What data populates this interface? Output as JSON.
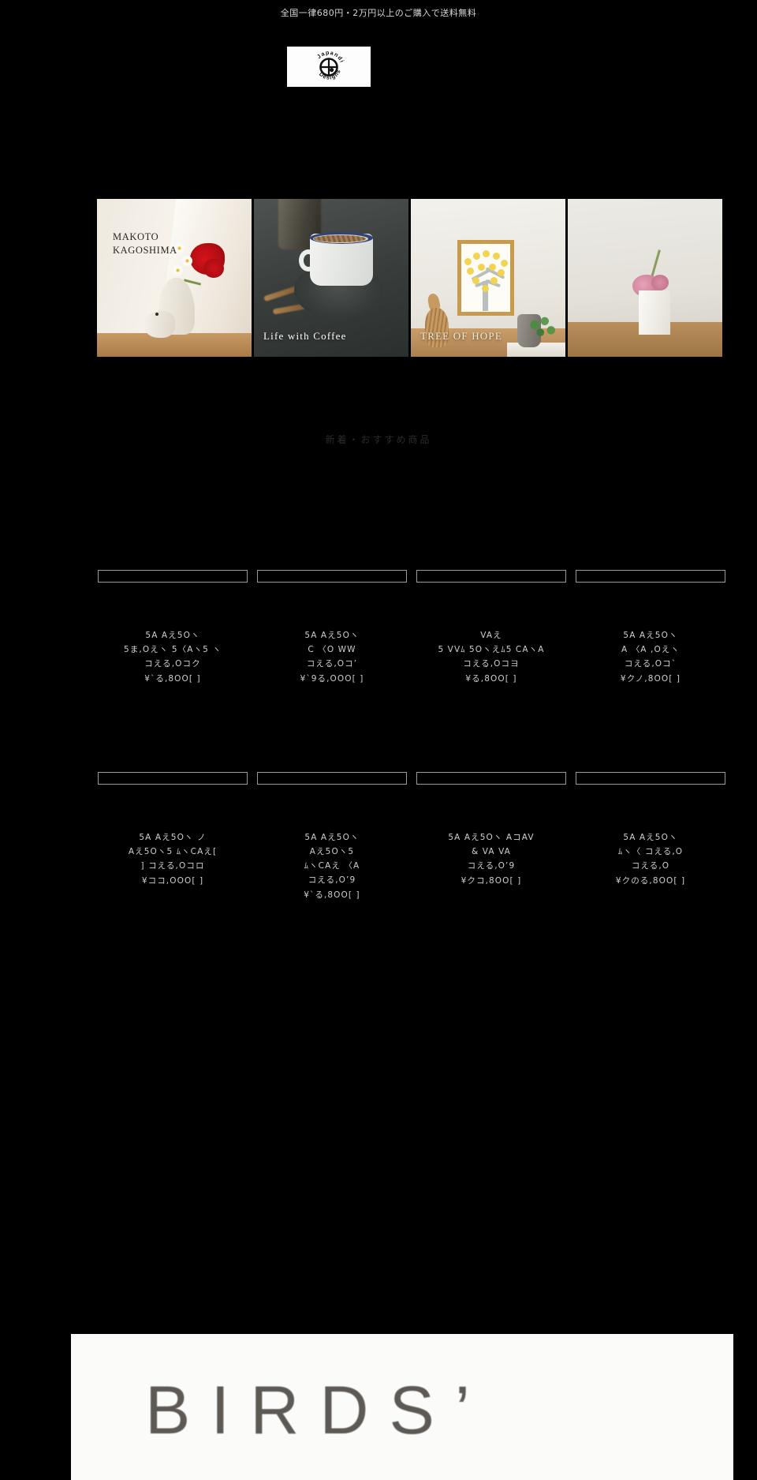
{
  "announcement": {
    "text": "全国一律680円・2万円以上のご購入で送料無料"
  },
  "logo": {
    "name": "Japandi Designs",
    "top_text": "Japandi",
    "bottom_text": "Designs",
    "background": "#fdfdfd",
    "mark_color": "#111111"
  },
  "carousel": {
    "slides": [
      {
        "caption": "MAKOTO\nKAGOSHIMA",
        "caption_line1": "MAKOTO",
        "caption_line2": "KAGOSHIMA",
        "position": "top-left",
        "style": "dark"
      },
      {
        "caption": "Life with Coffee",
        "position": "bottom-left",
        "style": "light"
      },
      {
        "caption": "TREE OF HOPE",
        "position": "bottom-left",
        "style": "cream"
      },
      {
        "caption": "",
        "position": "bottom-left",
        "style": "light"
      }
    ]
  },
  "section": {
    "heading": "新着・おすすめ商品"
  },
  "products": {
    "row1": [
      {
        "title": "5A Aえ5Oヽ\n5ま,Oえヽ  5〈Aヽ5 ヽ\nコえる,Oコク",
        "line1": "5A  Aえ5Oヽ",
        "line2": "5ま,Oえヽ    5〈Aヽ5 ヽ",
        "line3": "コえる,Oコク",
        "price": "¥`る,8OO[ ]"
      },
      {
        "title": "5A Aえ5Oヽ\nC  〈O  WW\nコえる,Oコ’",
        "line1": "5A  Aえ5Oヽ",
        "line2": "C   〈O   WW",
        "line3": "コえる,Oコ’",
        "price": "¥`9る,OOO[ ]"
      },
      {
        "title": "VAえ\n5 VVﾑ 5Oヽえﾑ5 CAヽA\nコえる,Oコヨ",
        "line1": "VAえ",
        "line2": "5 VVﾑ 5Oヽえﾑ5 CAヽA",
        "line3": "コえる,Oコヨ",
        "price": "¥る,8OO[ ]"
      },
      {
        "title": "5A Aえ5Oヽ\nA  〈A  ,Oえヽ\nコえる,Oコ`",
        "line1": "5A  Aえ5Oヽ",
        "line2": "A   〈A   ,Oえヽ",
        "line3": "コえる,Oコ`",
        "price": "¥クノ,8OO[ ]"
      }
    ],
    "row2": [
      {
        "title": "5A Aえ5Oヽ ノ\nAえ5Oヽ5 ﾑヽCAえ[\n]   コえる,Oコロ",
        "line1": "5A  Aえ5Oヽ ノ",
        "line2": "Aえ5Oヽ5 ﾑヽCAえ[",
        "line3": "]     コえる,Oコロ",
        "price": "¥ココ,OOO[ ]"
      },
      {
        "title": "5A Aえ5Oヽ\nAえ5Oヽ5\nﾑヽCAえ   〈A\nコえる,O’9",
        "line1": "5A  Aえ5Oヽ",
        "line2": "Aえ5Oヽ5",
        "line3": "ﾑヽCAえ    〈A",
        "line4": "コえる,O’9",
        "price": "¥`る,8OO[ ]"
      },
      {
        "title": "5A Aえ5Oヽ AコAV\n&  VA    VA\nコえる,O’9",
        "line1": "5A  Aえ5Oヽ AコAV",
        "line2": "&  VA       VA",
        "line3": "コえる,O’9",
        "price": "¥クコ,8OO[ ]"
      },
      {
        "title": "5A Aえ5Oヽ\nﾑヽ〈   コえる,O\nコえる,O",
        "line1": "5A  Aえ5Oヽ",
        "line2": "ﾑヽ〈        コえる,O",
        "line3": "",
        "price": "¥クのる,8OO[ ]"
      }
    ]
  },
  "banner": {
    "word": "BIRDS’",
    "background": "#fbfbfa",
    "text_color": "#5d5a56"
  }
}
